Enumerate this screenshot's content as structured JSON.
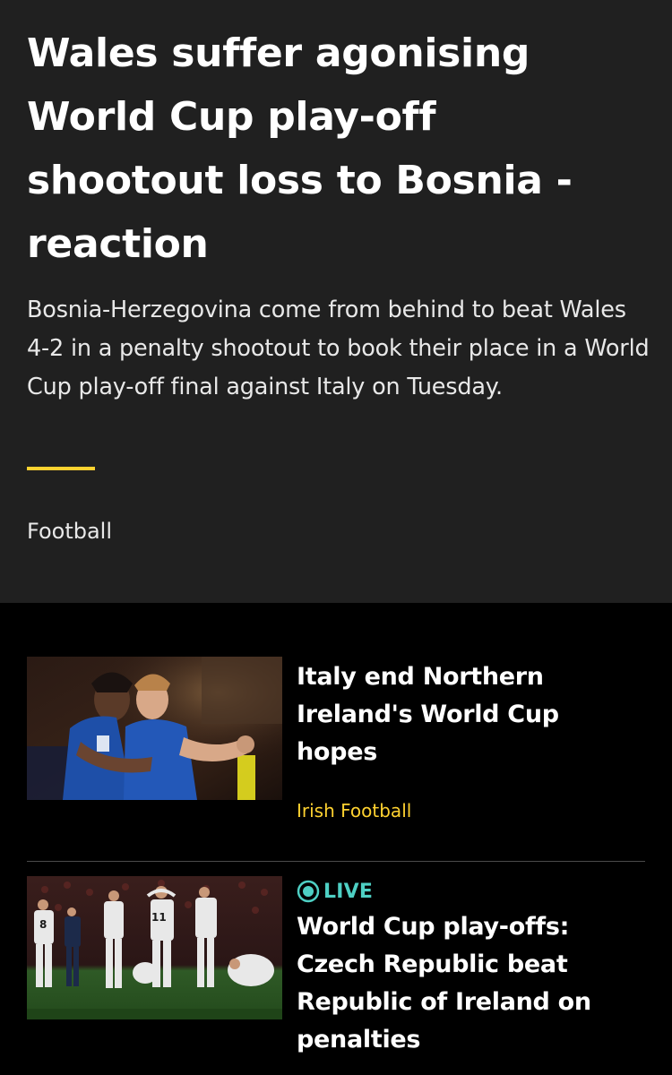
{
  "hero": {
    "title": "Wales suffer agonising World Cup play-off shootout loss to Bosnia - reaction",
    "summary": "Bosnia-Herzegovina come from behind to beat Wales 4-2 in a penalty shootout to book their place in a World Cup play-off final against Italy on Tuesday.",
    "topic": "Football"
  },
  "stories": [
    {
      "title": "Italy end Northern Ireland's World Cup hopes",
      "topic": "Irish Football",
      "image_icon": "football-players-celebrating-image"
    },
    {
      "badge": "LIVE",
      "badge_icon": "live-icon",
      "title": "World Cup play-offs: Czech Republic beat Republic of Ireland on penalties",
      "image_icon": "players-dejected-after-shootout-image"
    }
  ],
  "colors": {
    "hero_background": "#202020",
    "page_background": "#000000",
    "accent_yellow": "#ffd230",
    "live_teal": "#4ed0c4",
    "text_primary": "#ffffff"
  }
}
